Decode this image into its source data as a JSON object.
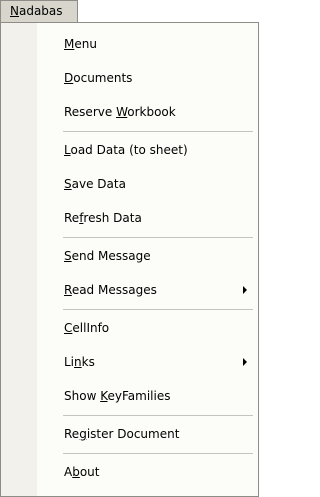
{
  "menubar": {
    "title_parts": [
      "",
      "N",
      "adabas"
    ]
  },
  "menu": {
    "items": [
      {
        "parts": [
          "",
          "M",
          "enu"
        ]
      },
      {
        "parts": [
          "",
          "D",
          "ocuments"
        ]
      },
      {
        "parts": [
          "Reserve ",
          "W",
          "orkbook"
        ]
      },
      {
        "parts": [
          "",
          "L",
          "oad Data (to sheet)"
        ]
      },
      {
        "parts": [
          "",
          "S",
          "ave Data"
        ]
      },
      {
        "parts": [
          "Re",
          "f",
          "resh Data"
        ]
      },
      {
        "parts": [
          "",
          "S",
          "end Message"
        ]
      },
      {
        "parts": [
          "",
          "R",
          "ead Messages"
        ],
        "submenu": true
      },
      {
        "parts": [
          "",
          "C",
          "ellInfo"
        ]
      },
      {
        "parts": [
          "Li",
          "n",
          "ks"
        ],
        "submenu": true
      },
      {
        "parts": [
          "Show ",
          "K",
          "eyFamilies"
        ]
      },
      {
        "parts": [
          "Re",
          "g",
          "ister Document"
        ]
      },
      {
        "parts": [
          "A",
          "b",
          "out"
        ]
      }
    ]
  }
}
